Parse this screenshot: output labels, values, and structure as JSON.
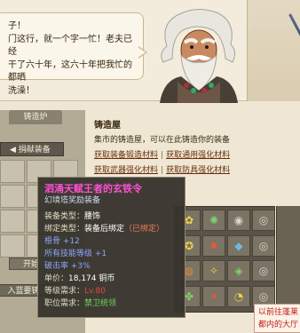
{
  "dialogue": {
    "lines": [
      "子！",
      "门这行，就一个字一忙！老夫已经",
      "干了六十年，这六十年把我忙的都晒",
      "洗澡！"
    ]
  },
  "npc": {
    "portrait_icon": "old-blacksmith-portrait"
  },
  "forge_panel": {
    "tab_label": "铸造炉",
    "donate_label": "◀ 捐献装备",
    "start_label": "开始锻造",
    "import_label": "入蓝要铸造"
  },
  "forge_house": {
    "title": "铸造屋",
    "description": "集市的铸造屋，可以在此铸造你的装备",
    "links": [
      [
        "获取装备锻造材料",
        "获取通用强化材料"
      ],
      [
        "获取武器强化材料",
        "获取防具强化材料"
      ]
    ]
  },
  "tooltip": {
    "title": "泗涌天赋王者的玄铁令",
    "subtitle": "幻境塔奖励装备",
    "equip_type_label": "装备类型：",
    "equip_type_value": "腰饰",
    "bind_type_label": "绑定类型：",
    "bind_type_value": "装备后绑定",
    "bind_status": "（已绑定）",
    "stat1": "根骨 +12",
    "stat2": "所有技能等级 +1",
    "stat3": "破击率 +3%",
    "price_label": "单价：",
    "price_value": "18,174 铜币",
    "level_label": "等级需求：",
    "level_value": "Lv.80",
    "job_label": "职位需求：",
    "job_value": "禁卫统领"
  },
  "inventory": {
    "cells": [
      "✿",
      "✺",
      "◉",
      "◎",
      "✪",
      "✸",
      "◆",
      "◎",
      "◍",
      "✧",
      "◈",
      "◎",
      "✤",
      "✦",
      "◔",
      "◎"
    ]
  },
  "notice": {
    "line1": "以前往蓬莱",
    "line2": "都内的大厅"
  },
  "colors": {
    "tooltip_title": "#ff4fd2",
    "stat_blue": "#8aa6ff",
    "stat_red": "#e0483c",
    "job_green": "#6fd060",
    "notice_red": "#c0201a"
  }
}
